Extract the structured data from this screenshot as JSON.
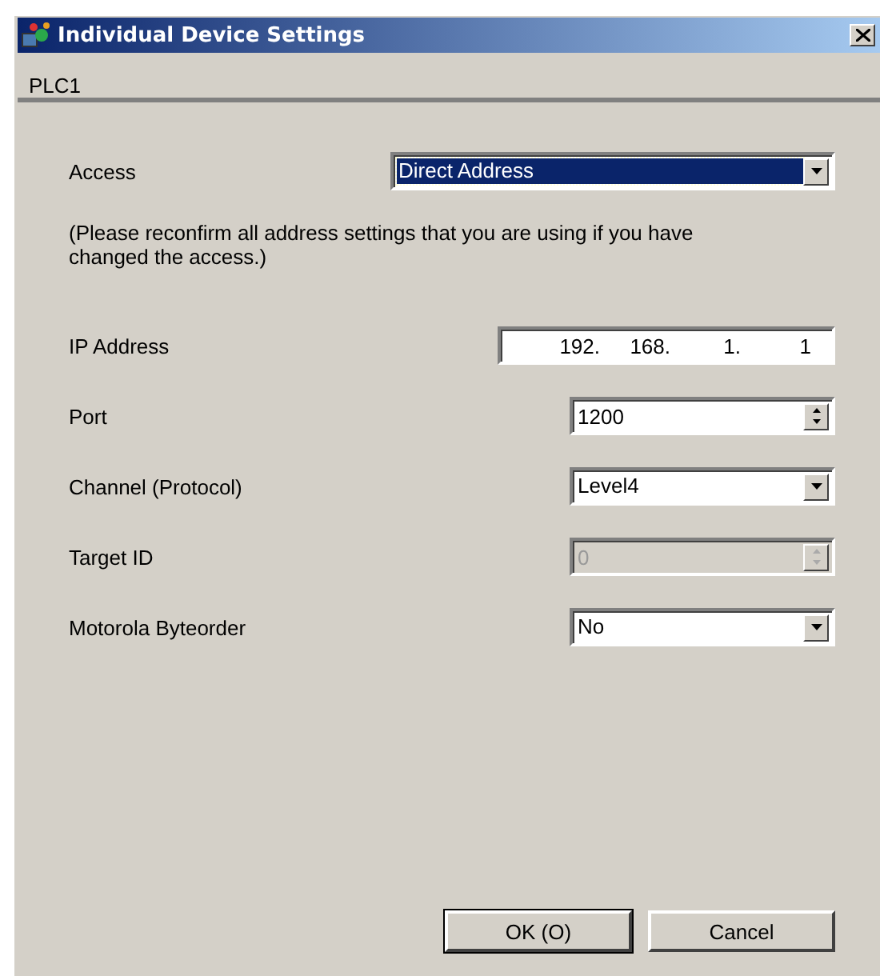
{
  "window": {
    "title": "Individual Device Settings"
  },
  "device": "PLC1",
  "settings": [
    {
      "kind": "combo",
      "label": "Access",
      "value": "Direct Address",
      "focused": true,
      "disabled": false
    },
    {
      "kind": "note",
      "text": "(Please reconfirm all address settings that you are using if you have changed the access.)"
    },
    {
      "kind": "ip",
      "label": "IP Address",
      "octets": [
        "192.",
        "168.",
        "1.",
        "1"
      ],
      "disabled": false
    },
    {
      "kind": "spin",
      "label": "Port",
      "value": "1200",
      "disabled": false
    },
    {
      "kind": "combo",
      "label": "Channel (Protocol)",
      "value": "Level4",
      "focused": false,
      "disabled": false
    },
    {
      "kind": "spin",
      "label": "Target ID",
      "value": "0",
      "disabled": true
    },
    {
      "kind": "combo",
      "label": "Motorola Byteorder",
      "value": "No",
      "focused": false,
      "disabled": false
    }
  ],
  "buttons": [
    {
      "label": "OK (O)",
      "default": true
    },
    {
      "label": "Cancel",
      "default": false
    }
  ]
}
